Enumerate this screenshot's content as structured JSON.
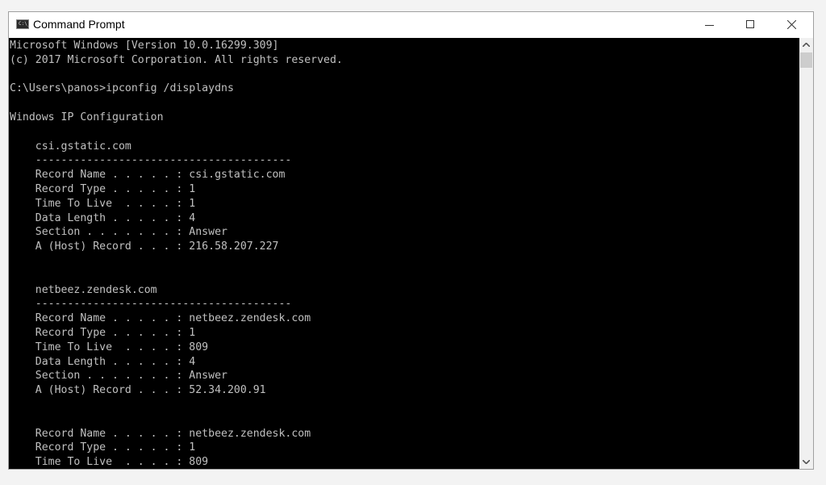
{
  "window": {
    "title": "Command Prompt",
    "icon": "cmd-icon",
    "icon_text": "C:\\_",
    "controls": [
      "minimize-icon",
      "maximize-icon",
      "close-icon"
    ]
  },
  "console": {
    "lines": [
      "Microsoft Windows [Version 10.0.16299.309]",
      "(c) 2017 Microsoft Corporation. All rights reserved.",
      "",
      "C:\\Users\\panos>ipconfig /displaydns",
      "",
      "Windows IP Configuration",
      "",
      "    csi.gstatic.com",
      "    ----------------------------------------",
      "    Record Name . . . . . : csi.gstatic.com",
      "    Record Type . . . . . : 1",
      "    Time To Live  . . . . : 1",
      "    Data Length . . . . . : 4",
      "    Section . . . . . . . : Answer",
      "    A (Host) Record . . . : 216.58.207.227",
      "",
      "",
      "    netbeez.zendesk.com",
      "    ----------------------------------------",
      "    Record Name . . . . . : netbeez.zendesk.com",
      "    Record Type . . . . . : 1",
      "    Time To Live  . . . . : 809",
      "    Data Length . . . . . : 4",
      "    Section . . . . . . . : Answer",
      "    A (Host) Record . . . : 52.34.200.91",
      "",
      "",
      "    Record Name . . . . . : netbeez.zendesk.com",
      "    Record Type . . . . . : 1",
      "    Time To Live  . . . . : 809"
    ]
  },
  "colors": {
    "console_bg": "#000000",
    "console_fg": "#c0c0c0",
    "titlebar_bg": "#ffffff"
  }
}
